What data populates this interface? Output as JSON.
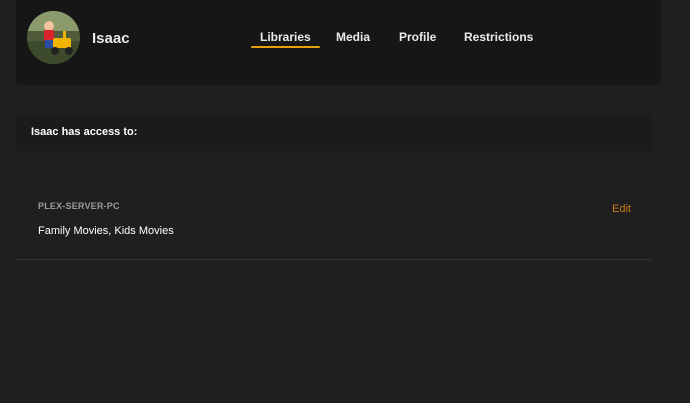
{
  "user": {
    "name": "Isaac"
  },
  "tabs": [
    {
      "label": "Libraries",
      "active": true
    },
    {
      "label": "Media",
      "active": false
    },
    {
      "label": "Profile",
      "active": false
    },
    {
      "label": "Restrictions",
      "active": false
    }
  ],
  "access": {
    "heading": "Isaac has access to:"
  },
  "servers": [
    {
      "name": "PLEX-SERVER-PC",
      "libraries": "Family Movies, Kids Movies",
      "edit_label": "Edit"
    }
  ],
  "colors": {
    "accent": "#e5a00d",
    "edit": "#cc7b19",
    "background": "#1f1f1f",
    "header": "#161616"
  }
}
